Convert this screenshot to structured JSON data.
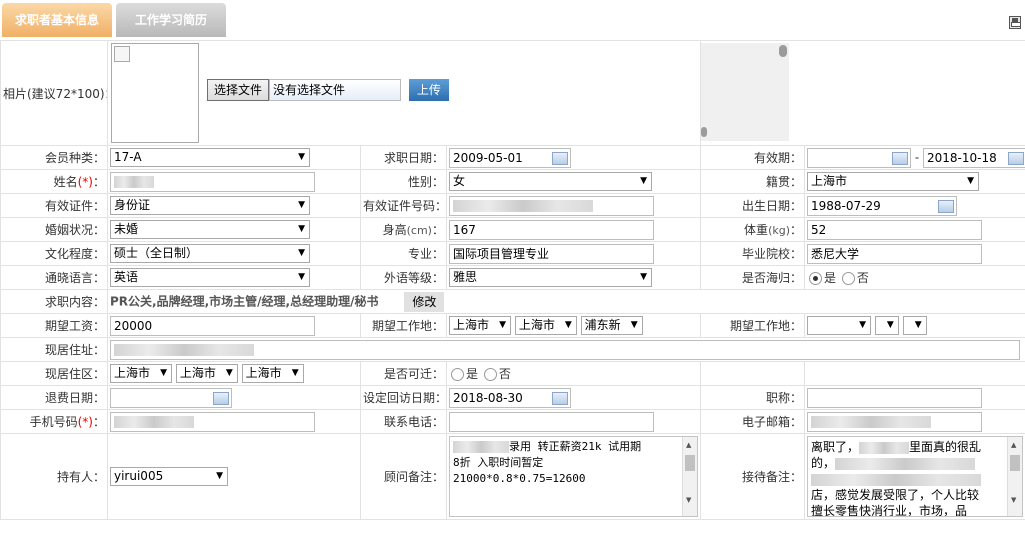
{
  "tabs": [
    {
      "label": "求职者基本信息"
    },
    {
      "label": "工作学习简历"
    }
  ],
  "photo": {
    "label": "相片(建议72*100)：",
    "choose_btn": "选择文件",
    "no_file": "没有选择文件",
    "upload_btn": "上传"
  },
  "row1": {
    "member_type_label": "会员种类：",
    "member_type_value": "17-A",
    "apply_date_label": "求职日期：",
    "apply_date_value": "2009-05-01",
    "valid_period_label": "有效期：",
    "valid_period_sep": "-",
    "valid_period_end": "2018-10-18"
  },
  "row2": {
    "name_label": "姓名",
    "name_req": "(*)",
    "colon": "：",
    "gender_label": "性别：",
    "gender_value": "女",
    "origin_label": "籍贯：",
    "origin_value": "上海市"
  },
  "row3": {
    "id_type_label": "有效证件：",
    "id_type_value": "身份证",
    "id_no_label": "有效证件号码：",
    "birth_label": "出生日期：",
    "birth_value": "1988-07-29"
  },
  "row4": {
    "marital_label": "婚姻状况：",
    "marital_value": "未婚",
    "height_label": "身高",
    "height_unit": "(cm)",
    "height_value": "167",
    "weight_label": "体重",
    "weight_unit": "(kg)",
    "weight_value": "52"
  },
  "row5": {
    "edu_label": "文化程度：",
    "edu_value": "硕士（全日制）",
    "major_label": "专业：",
    "major_value": "国际项目管理专业",
    "school_label": "毕业院校：",
    "school_value": "悉尼大学"
  },
  "row6": {
    "lang_label": "通晓语言：",
    "lang_value": "英语",
    "lang_level_label": "外语等级：",
    "lang_level_value": "雅思",
    "returnee_label": "是否海归：",
    "yes": "是",
    "no": "否"
  },
  "row7": {
    "job_content_label": "求职内容：",
    "job_content_value": "PR公关,品牌经理,市场主管/经理,总经理助理/秘书",
    "edit_btn": "修改"
  },
  "row8": {
    "salary_label": "期望工资：",
    "salary_value": "20000",
    "work_loc_label": "期望工作地：",
    "loc1": "上海市",
    "loc2": "上海市",
    "loc3": "浦东新",
    "work_loc2_label": "期望工作地："
  },
  "row9": {
    "address_label": "现居住址："
  },
  "row10": {
    "district_label": "现居住区：",
    "d1": "上海市",
    "d2": "上海市",
    "d3": "上海市",
    "relocate_label": "是否可迁：",
    "yes": "是",
    "no": "否"
  },
  "row11": {
    "refund_label": "退费日期：",
    "revisit_label": "设定回访日期：",
    "revisit_value": "2018-08-30",
    "title_label": "职称："
  },
  "row12": {
    "mobile_label": "手机号码",
    "mobile_req": "(*)",
    "colon": "：",
    "phone_label": "联系电话：",
    "email_label": "电子邮箱："
  },
  "row13": {
    "holder_label": "持有人：",
    "holder_value": "yirui005",
    "advisor_note_label": "顾问备注：",
    "advisor_note_line1": "录用  转正薪资21k 试用期",
    "advisor_note_line2": "8折  入职时间暂定",
    "advisor_note_line3": "21000*0.8*0.75=12600",
    "reception_note_label": "接待备注：",
    "reception_line1": "离职了，",
    "reception_line1b": "里面真的很乱",
    "reception_line2": "的，",
    "reception_line3": "店，感觉发展受限了，个人比较",
    "reception_line4": "擅长零售快消行业，市场，品"
  }
}
